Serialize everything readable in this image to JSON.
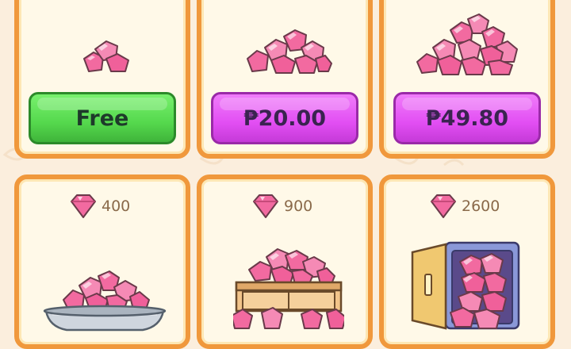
{
  "shop": {
    "top_row": [
      {
        "price_label": "Free",
        "price_kind": "free"
      },
      {
        "price_label": "₱20.00",
        "price_kind": "paid"
      },
      {
        "price_label": "₱49.80",
        "price_kind": "paid"
      }
    ],
    "bottom_row": [
      {
        "gem_amount": "400",
        "art": "gem-bowl"
      },
      {
        "gem_amount": "900",
        "art": "gem-crate"
      },
      {
        "gem_amount": "2600",
        "art": "gem-safe"
      }
    ]
  },
  "colors": {
    "card_border": "#f0983c",
    "card_fill": "#fff9e8",
    "free_button": "#55d84d",
    "buy_button": "#e24ef3",
    "gem_pink": "#f0609a",
    "background": "#fbeedd"
  },
  "icons": [
    "gem-icon",
    "gem-pile-icon",
    "gem-bowl-icon",
    "gem-crate-icon",
    "gem-safe-icon"
  ]
}
